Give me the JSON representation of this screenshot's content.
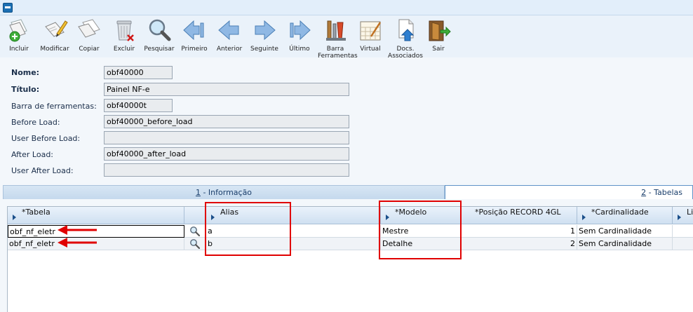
{
  "toolbar": {
    "buttons": [
      {
        "key": "incluir",
        "label": "Incluir",
        "icon": "add-document-icon"
      },
      {
        "key": "modificar",
        "label": "Modificar",
        "icon": "edit-document-icon"
      },
      {
        "key": "copiar",
        "label": "Copiar",
        "icon": "copy-document-icon"
      },
      {
        "key": "excluir",
        "label": "Excluir",
        "icon": "trash-icon"
      },
      {
        "key": "pesquisar",
        "label": "Pesquisar",
        "icon": "magnifier-icon"
      },
      {
        "key": "primeiro",
        "label": "Primeiro",
        "icon": "first-arrow-icon"
      },
      {
        "key": "anterior",
        "label": "Anterior",
        "icon": "left-arrow-icon"
      },
      {
        "key": "seguinte",
        "label": "Seguinte",
        "icon": "right-arrow-icon"
      },
      {
        "key": "ultimo",
        "label": "Último",
        "icon": "last-arrow-icon"
      },
      {
        "key": "barra",
        "label": "Barra Ferramentas",
        "icon": "tools-icon"
      },
      {
        "key": "virtual",
        "label": "Virtual",
        "icon": "calendar-icon"
      },
      {
        "key": "docs",
        "label": "Docs. Associados",
        "icon": "upload-document-icon"
      },
      {
        "key": "sair",
        "label": "Sair",
        "icon": "exit-door-icon"
      }
    ]
  },
  "form": {
    "nome_label": "Nome:",
    "nome_value": "obf40000",
    "titulo_label": "Título:",
    "titulo_value": "Painel NF-e",
    "barra_label": "Barra de ferramentas:",
    "barra_value": "obf40000t",
    "before_label": "Before Load:",
    "before_value": "obf40000_before_load",
    "user_before_label": "User Before Load:",
    "user_before_value": "",
    "after_label": "After Load:",
    "after_value": "obf40000_after_load",
    "user_after_label": "User After Load:",
    "user_after_value": ""
  },
  "tabs": {
    "info": {
      "num": "1",
      "label": " - Informação"
    },
    "tables": {
      "num": "2",
      "label": " - Tabelas"
    }
  },
  "grid": {
    "headers": {
      "tabela": "*Tabela",
      "alias": "Alias",
      "modelo": "*Modelo",
      "posicao": "*Posição RECORD 4GL",
      "cardinalidade": "*Cardinalidade",
      "li": "Li"
    },
    "rows": [
      {
        "tabela": "obf_nf_eletr",
        "alias": "a",
        "modelo": "Mestre",
        "posicao": "1",
        "cardinalidade": "Sem Cardinalidade"
      },
      {
        "tabela": "obf_nf_eletr",
        "alias": "b",
        "modelo": "Detalhe",
        "posicao": "2",
        "cardinalidade": "Sem Cardinalidade"
      }
    ]
  },
  "colors": {
    "annotation_red": "#e00000",
    "label_navy": "#1a2e4a",
    "tab_active_border": "#5f93c8"
  }
}
